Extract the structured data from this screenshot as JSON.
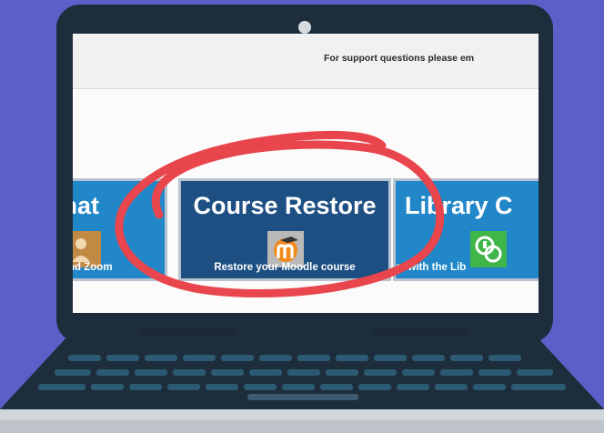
{
  "screen": {
    "support_text": "For support questions please em"
  },
  "tiles": [
    {
      "id": "chat",
      "title": "Chat",
      "caption": "nd Zoom",
      "icon": "chat-person-icon",
      "color": "#2187c8"
    },
    {
      "id": "course-restore",
      "title": "Course Restore",
      "caption": "Restore your Moodle course",
      "icon": "moodle-logo-icon",
      "color": "#1d4f83"
    },
    {
      "id": "library-chat",
      "title": "Library C",
      "caption": "at with the Lib",
      "icon": "speech-bubbles-icon",
      "color": "#2187c8"
    }
  ],
  "accent_colors": {
    "background": "#5b5fc7",
    "laptop_body": "#1e2d3b",
    "circle_scribble": "#e8464c",
    "keys": "#2c5a73"
  }
}
